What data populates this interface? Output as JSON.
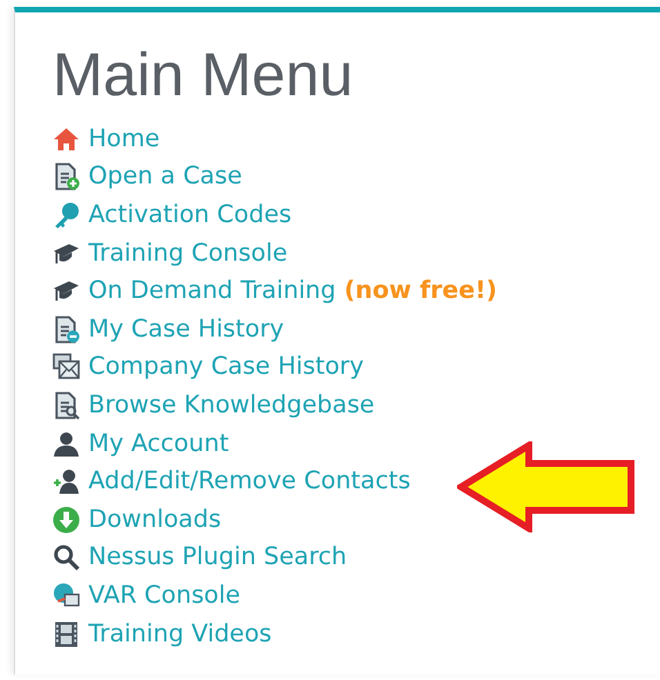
{
  "title": "Main Menu",
  "items": [
    {
      "label": "Home",
      "kind": "home"
    },
    {
      "label": "Open a Case",
      "kind": "doc-add"
    },
    {
      "label": "Activation Codes",
      "kind": "key"
    },
    {
      "label": "Training Console",
      "kind": "cap"
    },
    {
      "label": "On Demand Training",
      "kind": "cap",
      "badge": "(now free!)"
    },
    {
      "label": "My Case History",
      "kind": "doc-minus"
    },
    {
      "label": "Company Case History",
      "kind": "mail"
    },
    {
      "label": "Browse Knowledgebase",
      "kind": "doc-search"
    },
    {
      "label": "My Account",
      "kind": "person"
    },
    {
      "label": "Add/Edit/Remove Contacts",
      "kind": "person-add"
    },
    {
      "label": "Downloads",
      "kind": "download"
    },
    {
      "label": "Nessus Plugin Search",
      "kind": "search"
    },
    {
      "label": "VAR Console",
      "kind": "globe"
    },
    {
      "label": "Training Videos",
      "kind": "film"
    }
  ]
}
